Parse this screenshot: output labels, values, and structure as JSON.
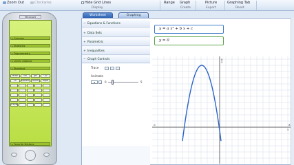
{
  "ribbon": {
    "zoom_out": "Zoom Out",
    "clockwise": "Clockwise",
    "hide_grid": "Hide Grid Lines",
    "display_group": "Display",
    "range": "Range",
    "graph": "Graph",
    "create_group": "Create",
    "picture": "Picture",
    "export_group": "Export",
    "graphing_tab": "Graphing Tab",
    "reset_group": "Reset"
  },
  "calculator": {
    "brand": "Microsoft",
    "menu": [
      "Calculus",
      "Statistics",
      "Trigonometry",
      "Linear Algebra",
      "Standard"
    ],
    "keys": [
      [
        "factor",
        "lim",
        "gcf",
        "\"10\""
      ],
      [
        "Ln",
        "expand",
        "round",
        "slope"
      ],
      [
        "",
        "",
        "",
        ""
      ],
      [
        "",
        "",
        "",
        ""
      ],
      [
        "",
        "",
        "",
        ""
      ],
      [
        "x true",
        "",
        "",
        ""
      ]
    ],
    "favorite": "Favorite Buttons",
    "accent": "#b9de43"
  },
  "tabs": {
    "worksheet": "Worksheet",
    "graphing": "Graphing"
  },
  "sidebar": {
    "sections": [
      "Equations & Functions",
      "Data Sets",
      "Parametric",
      "Inequalities",
      "Graph Controls"
    ],
    "trace_label": "Trace",
    "animate_label": "Animate",
    "animate_var": "a",
    "slider_min": "0",
    "slider_max": "5"
  },
  "equations": {
    "eq1": "y = a x² + b x + c",
    "eq2": "y = 0"
  },
  "graph": {
    "x_label": "x",
    "y_label": "y",
    "tick_pos": "5",
    "tick_neg": "-5",
    "curve_color": "#2a63c8"
  }
}
